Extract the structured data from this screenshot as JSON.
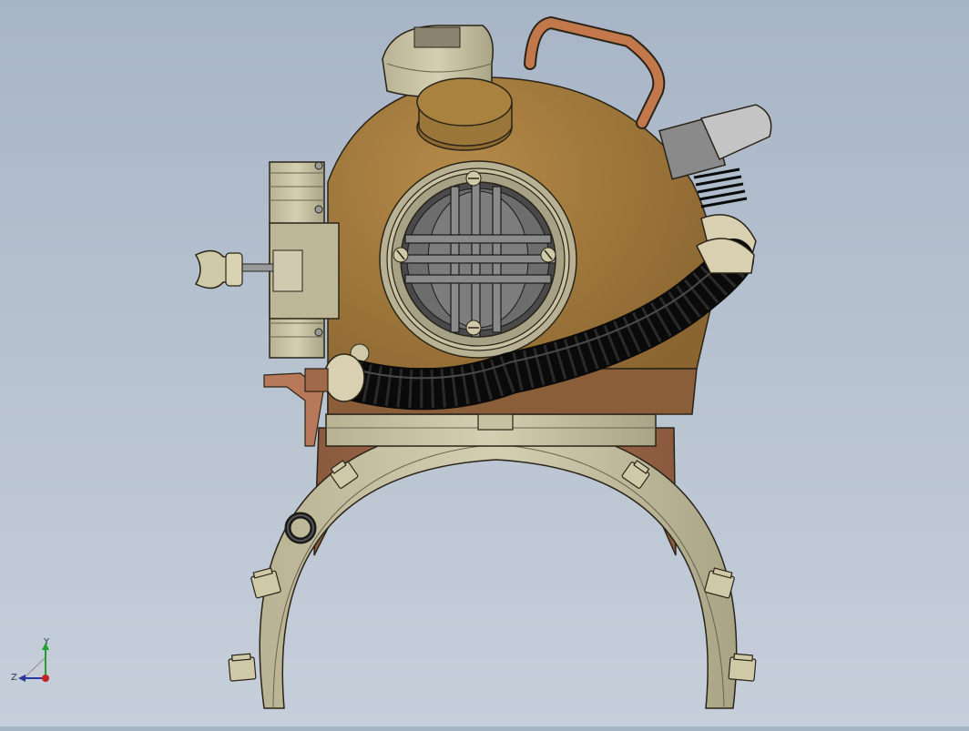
{
  "viewport": {
    "background_top": "#a8b5c6",
    "background_bottom": "#c6cfda"
  },
  "model": {
    "name": "diving-helmet",
    "colors": {
      "bronze_body": "#a07a3c",
      "copper_base": "#9a6446",
      "metal_part": "#c8c2a2",
      "hose_black": "#1a1a1a",
      "copper_tube": "#c2784a",
      "outline": "#2a2418"
    }
  },
  "triad": {
    "x_label": "",
    "y_label": "Y",
    "z_label": "Z",
    "x_color": "#c42222",
    "y_color": "#22a22a",
    "z_color": "#2a3a9a"
  }
}
